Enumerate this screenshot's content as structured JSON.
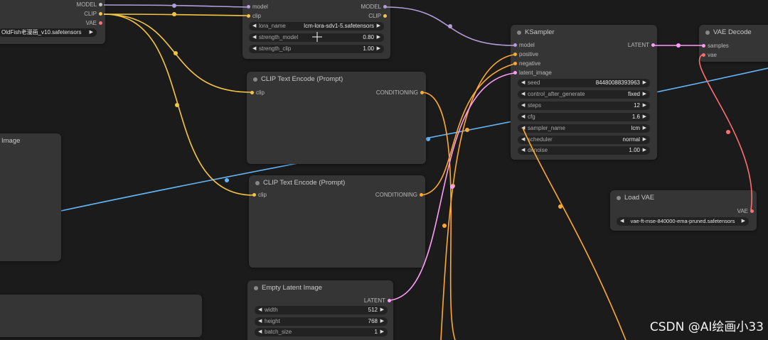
{
  "checkpoint_node": {
    "outputs": [
      "MODEL",
      "CLIP",
      "VAE"
    ],
    "ckpt_value": "OldFish老漫画_v10.safetensors"
  },
  "lora_node": {
    "inputs": [
      "model",
      "clip"
    ],
    "outputs": [
      "MODEL",
      "CLIP"
    ],
    "widgets": [
      {
        "label": "lora_name",
        "value": "lcm-lora-sdv1-5.safetensors"
      },
      {
        "label": "strength_model",
        "value": "0.80"
      },
      {
        "label": "strength_clip",
        "value": "1.00"
      }
    ]
  },
  "clip_text_encode_1": {
    "title": "CLIP Text Encode (Prompt)",
    "input": "clip",
    "output": "CONDITIONING"
  },
  "clip_text_encode_2": {
    "title": "CLIP Text Encode (Prompt)",
    "input": "clip",
    "output": "CONDITIONING"
  },
  "image_node": {
    "title": "Image"
  },
  "empty_latent": {
    "title": "Empty Latent Image",
    "output": "LATENT",
    "widgets": [
      {
        "label": "width",
        "value": "512"
      },
      {
        "label": "height",
        "value": "768"
      },
      {
        "label": "batch_size",
        "value": "1"
      }
    ]
  },
  "ksampler": {
    "title": "KSampler",
    "inputs": [
      "model",
      "positive",
      "negative",
      "latent_image"
    ],
    "output": "LATENT",
    "widgets": [
      {
        "label": "seed",
        "value": "84480088393963"
      },
      {
        "label": "control_after_generate",
        "value": "fixed"
      },
      {
        "label": "steps",
        "value": "12"
      },
      {
        "label": "cfg",
        "value": "1.6"
      },
      {
        "label": "sampler_name",
        "value": "lcm"
      },
      {
        "label": "scheduler",
        "value": "normal"
      },
      {
        "label": "denoise",
        "value": "1.00"
      }
    ]
  },
  "vae_decode": {
    "title": "VAE Decode",
    "inputs": [
      "samples",
      "vae"
    ]
  },
  "load_vae": {
    "title": "Load VAE",
    "output": "VAE",
    "vae_name": "vae-ft-mse-840000-ema-pruned.safetensors"
  },
  "watermark": "CSDN @AI绘画小33",
  "colors": {
    "model": "#b39ddb",
    "clip": "#f5c542",
    "vae": "#ff6e6e",
    "latent": "#ff9cf9",
    "conditioning": "#ffa931",
    "image": "#64b5f6",
    "node_bg": "#353535",
    "canvas_bg": "#1b1b1b"
  }
}
